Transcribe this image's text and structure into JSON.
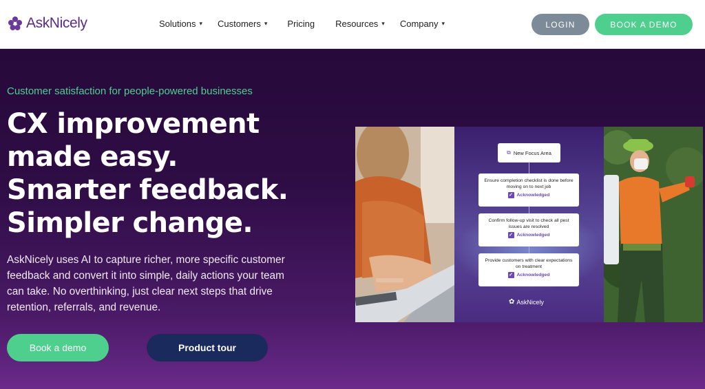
{
  "brand": {
    "name": "AskNicely"
  },
  "nav": {
    "items": [
      {
        "label": "Solutions",
        "has_dropdown": true
      },
      {
        "label": "Customers",
        "has_dropdown": true
      },
      {
        "label": "Pricing",
        "has_dropdown": false
      },
      {
        "label": "Resources",
        "has_dropdown": true
      },
      {
        "label": "Company",
        "has_dropdown": true
      }
    ],
    "login_label": "LOGIN",
    "book_demo_label": "BOOK A DEMO"
  },
  "hero": {
    "eyebrow": "Customer satisfaction for people-powered businesses",
    "headline_lines": [
      "CX improvement",
      "made easy.",
      "Smarter feedback.",
      "Simpler change."
    ],
    "description": "AskNicely uses AI to capture richer, more specific customer feedback and convert it into simple, daily actions your team can take. No overthinking, just clear next steps that drive retention, referrals, and revenue.",
    "primary_cta": "Book a demo",
    "secondary_cta": "Product tour"
  },
  "collage": {
    "focus_title": "New Focus Area",
    "tasks": [
      {
        "text": "Ensure completion checklist is done before moving on to next job",
        "status": "Acknowledged"
      },
      {
        "text": "Confirm follow-up visit to check all pest issues are resolved",
        "status": "Acknowledged"
      },
      {
        "text": "Provide customers with clear expectations on treatment",
        "status": "Acknowledged"
      }
    ],
    "panel_brand": "AskNicely"
  },
  "colors": {
    "accent_green": "#4ecf8e",
    "brand_purple": "#5a2a8a",
    "navy": "#1b2a5c",
    "login_gray": "#7d8b99"
  }
}
